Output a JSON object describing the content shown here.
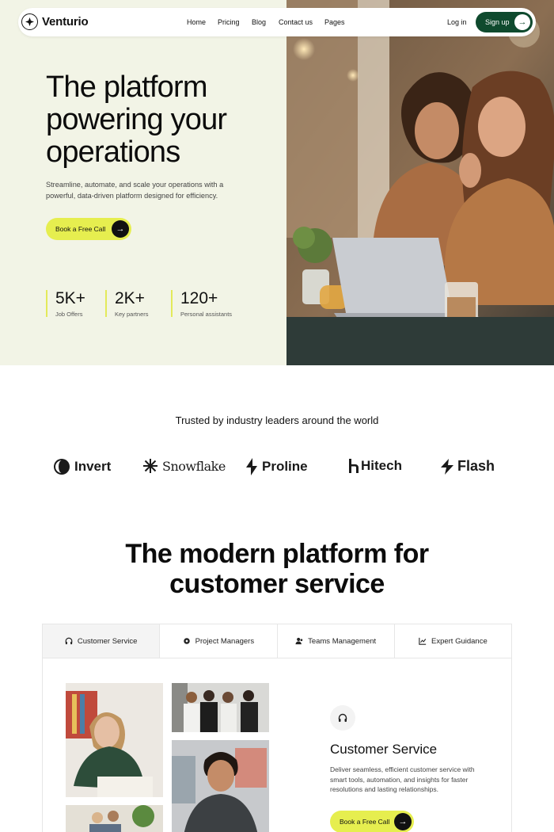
{
  "nav": {
    "brand": "Venturio",
    "links": [
      "Home",
      "Pricing",
      "Blog",
      "Contact us",
      "Pages"
    ],
    "login": "Log in",
    "signup": "Sign up"
  },
  "hero": {
    "title": "The platform powering your operations",
    "subtitle": "Streamline, automate, and scale your operations with a powerful, data-driven platform designed for efficiency.",
    "cta": "Book a Free Call",
    "stats": [
      {
        "value": "5K+",
        "label": "Job Offers"
      },
      {
        "value": "2K+",
        "label": "Key partners"
      },
      {
        "value": "120+",
        "label": "Personal assistants"
      }
    ]
  },
  "trusted": {
    "heading": "Trusted by industry leaders around the world",
    "brands": [
      "Invert",
      "Snowflake",
      "Proline",
      "Hitech",
      "Flash"
    ]
  },
  "platform": {
    "title_line1": "The modern platform for",
    "title_line2": "customer service",
    "tabs": [
      {
        "label": "Customer Service",
        "icon": "headphones-icon"
      },
      {
        "label": "Project Managers",
        "icon": "gear-icon"
      },
      {
        "label": "Teams Management",
        "icon": "team-icon"
      },
      {
        "label": "Expert Guidance",
        "icon": "chart-icon"
      }
    ],
    "service": {
      "title": "Customer Service",
      "description": "Deliver seamless, efficient customer service with smart tools, automation, and insights for faster resolutions and lasting relationships.",
      "cta": "Book a Free Call"
    }
  },
  "colors": {
    "accent": "#e6ee4f",
    "brand_green": "#0f4a2e",
    "hero_bg": "#f2f4e6"
  }
}
